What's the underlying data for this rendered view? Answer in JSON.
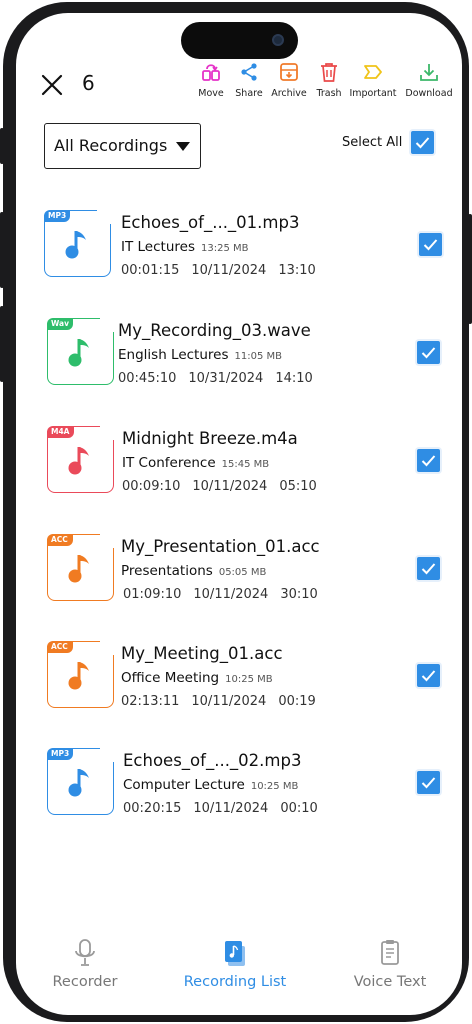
{
  "header": {
    "selected_count": "6",
    "actions": [
      {
        "label": "Move",
        "icon": "move-icon",
        "color": "#e532c8"
      },
      {
        "label": "Share",
        "icon": "share-icon",
        "color": "#2f8de4"
      },
      {
        "label": "Archive",
        "icon": "archive-icon",
        "color": "#f07b2b"
      },
      {
        "label": "Trash",
        "icon": "trash-icon",
        "color": "#ea4a4a"
      },
      {
        "label": "Important",
        "icon": "important-tag-icon",
        "color": "#f0c419"
      },
      {
        "label": "Download",
        "icon": "download-icon",
        "color": "#3cb86a"
      }
    ]
  },
  "filter": {
    "selected": "All Recordings",
    "select_all_label": "Select All",
    "select_all_checked": true
  },
  "recordings": [
    {
      "ext": "MP3",
      "color": "#2f8de4",
      "name": "Echoes_of_..._01.mp3",
      "category": "IT Lectures",
      "size": "13:25 MB",
      "duration": "00:01:15",
      "date": "10/11/2024",
      "time": "13:10",
      "checked": true
    },
    {
      "ext": "Wav",
      "color": "#2ebd6b",
      "name": "My_Recording_03.wave",
      "category": "English Lectures",
      "size": "11:05 MB",
      "duration": "00:45:10",
      "date": "10/31/2024",
      "time": "14:10",
      "checked": true
    },
    {
      "ext": "M4A",
      "color": "#ea4a5a",
      "name": "Midnight Breeze.m4a",
      "category": "IT Conference",
      "size": "15:45 MB",
      "duration": "00:09:10",
      "date": "10/11/2024",
      "time": "05:10",
      "checked": true
    },
    {
      "ext": "ACC",
      "color": "#f07b22",
      "name": "My_Presentation_01.acc",
      "category": "Presentations",
      "size": "05:05 MB",
      "duration": "01:09:10",
      "date": "10/11/2024",
      "time": "30:10",
      "checked": true
    },
    {
      "ext": "ACC",
      "color": "#f07b22",
      "name": "My_Meeting_01.acc",
      "category": "Office Meeting",
      "size": "10:25 MB",
      "duration": "02:13:11",
      "date": "10/11/2024",
      "time": "00:19",
      "checked": true
    },
    {
      "ext": "MP3",
      "color": "#2f8de4",
      "name": "Echoes_of_..._02.mp3",
      "category": "Computer Lecture",
      "size": "10:25 MB",
      "duration": "00:20:15",
      "date": "10/11/2024",
      "time": "00:10",
      "checked": true
    }
  ],
  "nav": [
    {
      "label": "Recorder",
      "icon": "microphone-icon",
      "active": false
    },
    {
      "label": "Recording List",
      "icon": "recording-list-icon",
      "active": true
    },
    {
      "label": "Voice Text",
      "icon": "voice-text-icon",
      "active": false
    }
  ],
  "colors": {
    "accent": "#2f8de4",
    "inactive": "#777777"
  }
}
